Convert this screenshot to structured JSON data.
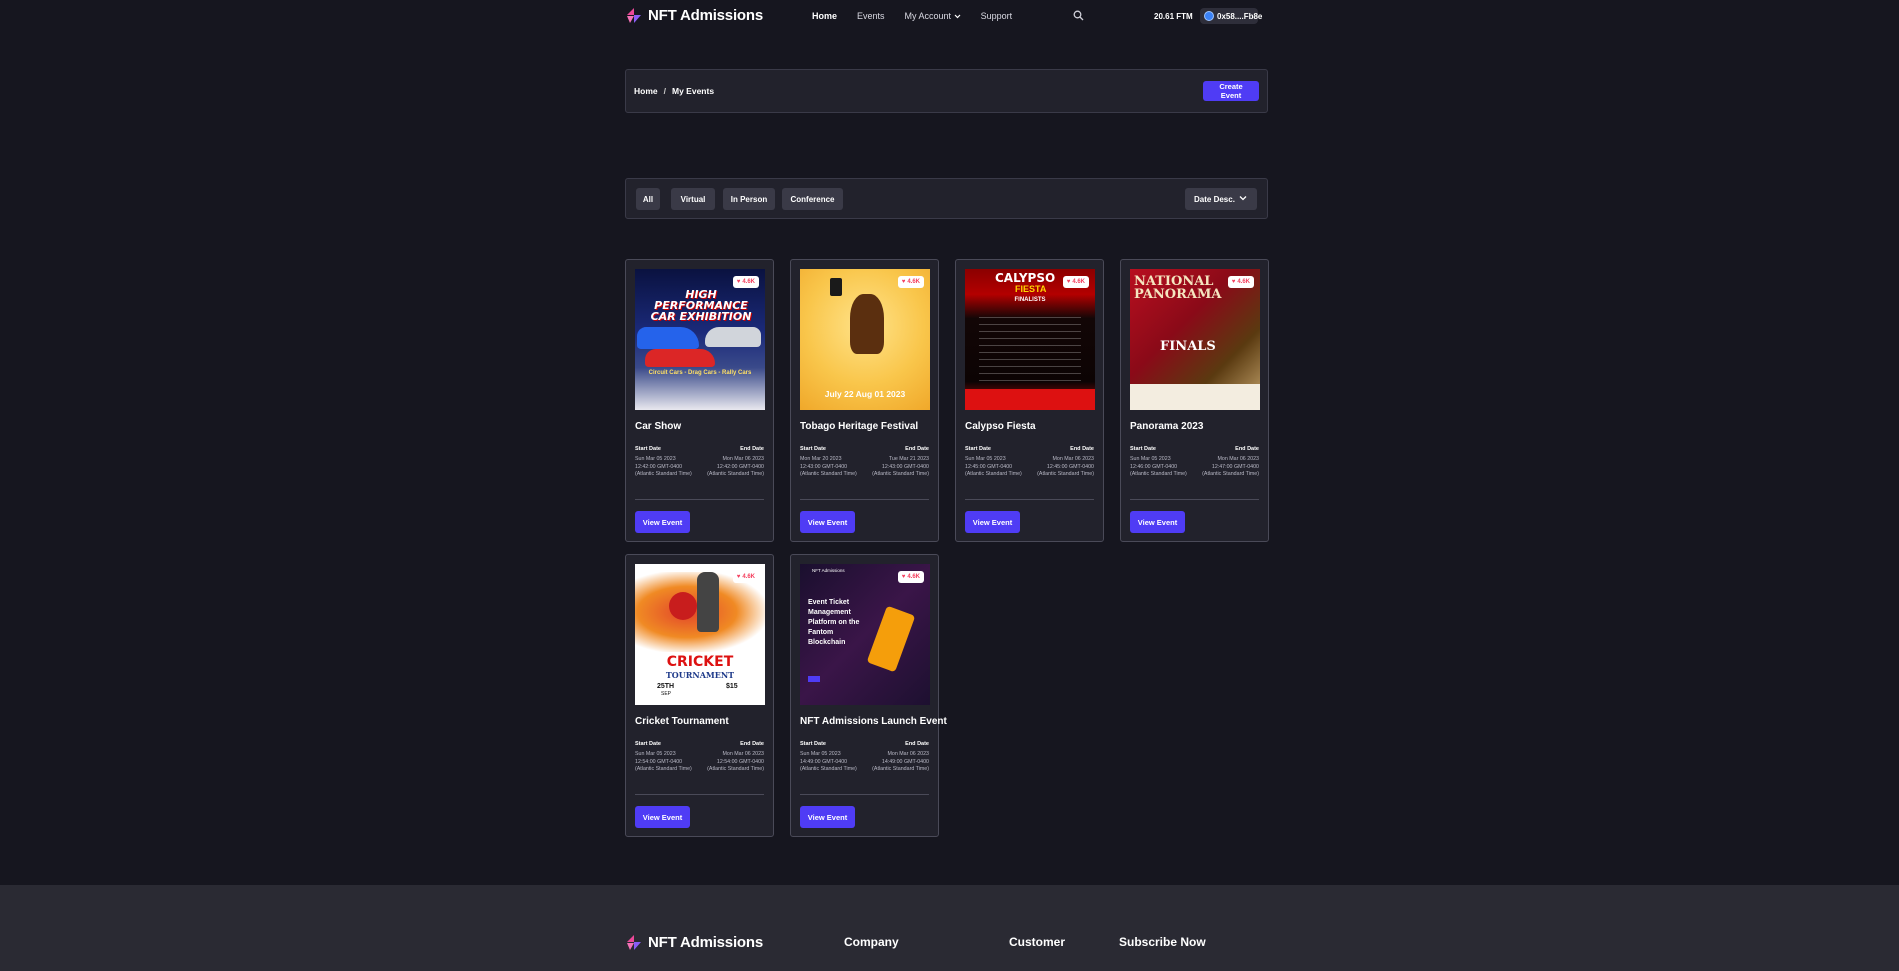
{
  "header": {
    "brand": "NFT Admissions",
    "nav": [
      "Home",
      "Events",
      "My Account",
      "Support"
    ],
    "balance": "20.61 FTM",
    "wallet": "0x58....Fb8e"
  },
  "breadcrumb": {
    "home": "Home",
    "separator": "/",
    "current": "My Events",
    "create_label": "Create Event"
  },
  "filters": {
    "tabs": [
      "All",
      "Virtual",
      "In Person",
      "Conference"
    ],
    "sort": "Date Desc."
  },
  "labels": {
    "start": "Start Date",
    "end": "End Date",
    "view": "View Event"
  },
  "events": [
    {
      "title": "Car Show",
      "likes": "4.6K",
      "start": "Sun Mar 05 2023 12:42:00 GMT-0400 (Atlantic Standard Time)",
      "end": "Mon Mar 06 2023 12:42:00 GMT-0400 (Atlantic Standard Time)"
    },
    {
      "title": "Tobago Heritage Festival",
      "likes": "4.6K",
      "start": "Mon Mar 20 2023 12:43:00 GMT-0400 (Atlantic Standard Time)",
      "end": "Tue Mar 21 2023 12:43:00 GMT-0400 (Atlantic Standard Time)"
    },
    {
      "title": "Calypso Fiesta",
      "likes": "4.6K",
      "start": "Sun Mar 05 2023 12:45:00 GMT-0400 (Atlantic Standard Time)",
      "end": "Mon Mar 06 2023 12:45:00 GMT-0400 (Atlantic Standard Time)"
    },
    {
      "title": "Panorama 2023",
      "likes": "4.6K",
      "start": "Sun Mar 05 2023 12:46:00 GMT-0400 (Atlantic Standard Time)",
      "end": "Mon Mar 06 2023 12:47:00 GMT-0400 (Atlantic Standard Time)"
    },
    {
      "title": "Cricket Tournament",
      "likes": "4.6K",
      "start": "Sun Mar 05 2023 12:54:00 GMT-0400 (Atlantic Standard Time)",
      "end": "Mon Mar 06 2023 12:54:00 GMT-0400 (Atlantic Standard Time)"
    },
    {
      "title": "NFT Admissions Launch Event",
      "likes": "4.6K",
      "start": "Sun Mar 05 2023 14:49:00 GMT-0400 (Atlantic Standard Time)",
      "end": "Mon Mar 06 2023 14:49:00 GMT-0400 (Atlantic Standard Time)"
    }
  ],
  "posters": {
    "car": {
      "line1": "HIGH PERFORMANCE",
      "line2": "CAR EXHIBITION",
      "tag": "Circuit Cars - Drag Cars - Rally Cars"
    },
    "tobago": {
      "dates": "July 22 Aug 01 2023"
    },
    "calypso": {
      "title": "CALYPSO",
      "title2": "FIESTA",
      "sub": "FINALISTS"
    },
    "panorama": {
      "title": "NATIONAL",
      "title2": "PANORAMA",
      "sub": "FINALS"
    },
    "cricket": {
      "title": "CRICKET",
      "sub": "TOURNAMENT",
      "day": "25TH",
      "month": "SEP",
      "price": "$15"
    },
    "launch": {
      "brand": "NFT Admissions",
      "headline": "Event Ticket Management Platform on the Fantom Blockchain"
    }
  },
  "footer": {
    "brand": "NFT Admissions",
    "cols": [
      "Company",
      "Customer",
      "Subscribe Now"
    ]
  },
  "colors": {
    "accent": "#4f3cf5",
    "bg": "#16161f",
    "panel": "#22222c"
  }
}
